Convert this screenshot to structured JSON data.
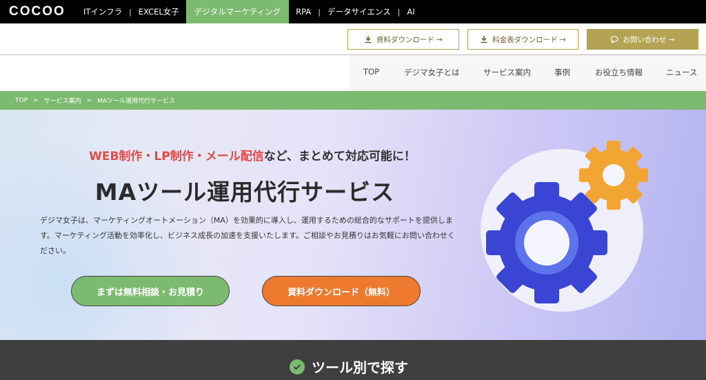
{
  "brand": {
    "logo": "COCOO"
  },
  "site_nav": [
    {
      "label": "ITインフラ",
      "active": false
    },
    {
      "label": "EXCEL女子",
      "active": false
    },
    {
      "label": "デジタルマーケティング",
      "active": true
    },
    {
      "label": "RPA",
      "active": false
    },
    {
      "label": "データサイエンス",
      "active": false
    },
    {
      "label": "AI",
      "active": false
    }
  ],
  "downloads": {
    "materials": "資料ダウンロード →",
    "pricing": "料金表ダウンロード →",
    "contact": "お問い合わせ →"
  },
  "main_nav": [
    "TOP",
    "デジマ女子とは",
    "サービス案内",
    "事例",
    "お役立ち情報",
    "ニュース"
  ],
  "breadcrumb": {
    "home": "TOP",
    "services": "サービス案内",
    "current": "MAツール運用代行サービス",
    "separator": ">"
  },
  "hero": {
    "tagline_highlight": "WEB制作・LP制作・メール配信",
    "tagline_rest": "など、まとめて対応可能に！",
    "title": "MAツール運用代行サービス",
    "description": "デジマ女子は、マーケティングオートメーション（MA）を効果的に導入し、運用するための総合的なサポートを提供します。マーケティング活動を効率化し、ビジネス成長の加速を支援いたします。ご相談やお見積りはお気軽にお問い合わせください。",
    "cta_primary": "まずは無料相談・お見積り",
    "cta_secondary": "資料ダウンロード（無料）"
  },
  "section": {
    "title": "ツール別で探す"
  },
  "colors": {
    "green": "#7cbb6f",
    "orange": "#ee7a2f",
    "gold": "#b3a352",
    "red": "#e04b47",
    "gear_blue": "#3b45d4",
    "gear_orange": "#f2a533"
  }
}
